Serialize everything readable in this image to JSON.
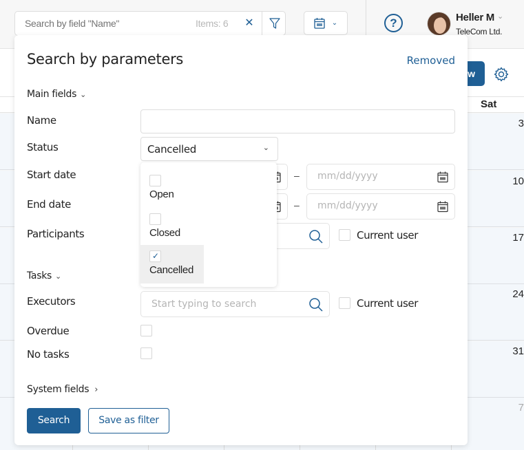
{
  "topbar": {
    "search_placeholder": "Search by field \"Name\"",
    "items_count": "Items: 6",
    "clear_icon": "close-icon",
    "filter_icon": "filter-icon",
    "calendar_icon": "calendar-icon",
    "help_icon": "help-icon",
    "user": {
      "name": "Heller M",
      "company": "TeleCom Ltd."
    }
  },
  "calendar": {
    "new_button_label": "w",
    "day_header": "Sat",
    "day_numbers": [
      "3",
      "10",
      "17",
      "24",
      "31",
      "7"
    ]
  },
  "panel": {
    "title": "Search by parameters",
    "removed_link": "Removed",
    "sections": {
      "main": "Main fields",
      "tasks": "Tasks",
      "system": "System fields"
    },
    "fields": {
      "name_label": "Name",
      "name_value": "",
      "status_label": "Status",
      "status_value": "Cancelled",
      "start_date_label": "Start date",
      "end_date_label": "End date",
      "date_placeholder": "mm/dd/yyyy",
      "date_separator": "–",
      "participants_label": "Participants",
      "current_user_label": "Current user",
      "executors_label": "Executors",
      "executors_placeholder": "Start typing to search",
      "overdue_label": "Overdue",
      "no_tasks_label": "No tasks"
    },
    "status_options": [
      {
        "label": "Open",
        "checked": false
      },
      {
        "label": "Closed",
        "checked": false
      },
      {
        "label": "Cancelled",
        "checked": true
      }
    ],
    "buttons": {
      "search": "Search",
      "save_filter": "Save as filter"
    }
  },
  "colors": {
    "accent": "#1f5f95",
    "calendar_bg": "#f3f7fb"
  }
}
